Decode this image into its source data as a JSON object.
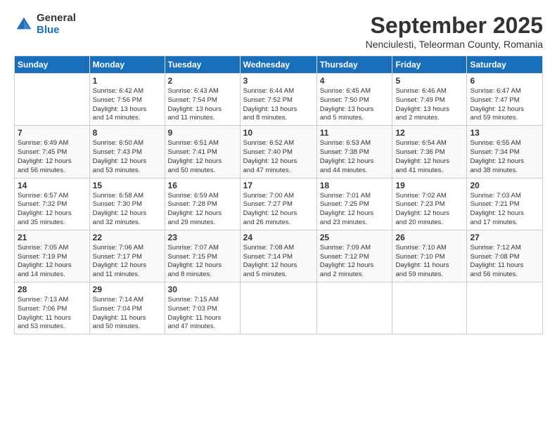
{
  "logo": {
    "general": "General",
    "blue": "Blue"
  },
  "title": "September 2025",
  "subtitle": "Nenciulesti, Teleorman County, Romania",
  "days_header": [
    "Sunday",
    "Monday",
    "Tuesday",
    "Wednesday",
    "Thursday",
    "Friday",
    "Saturday"
  ],
  "weeks": [
    [
      {
        "num": "",
        "detail": ""
      },
      {
        "num": "1",
        "detail": "Sunrise: 6:42 AM\nSunset: 7:56 PM\nDaylight: 13 hours\nand 14 minutes."
      },
      {
        "num": "2",
        "detail": "Sunrise: 6:43 AM\nSunset: 7:54 PM\nDaylight: 13 hours\nand 11 minutes."
      },
      {
        "num": "3",
        "detail": "Sunrise: 6:44 AM\nSunset: 7:52 PM\nDaylight: 13 hours\nand 8 minutes."
      },
      {
        "num": "4",
        "detail": "Sunrise: 6:45 AM\nSunset: 7:50 PM\nDaylight: 13 hours\nand 5 minutes."
      },
      {
        "num": "5",
        "detail": "Sunrise: 6:46 AM\nSunset: 7:49 PM\nDaylight: 13 hours\nand 2 minutes."
      },
      {
        "num": "6",
        "detail": "Sunrise: 6:47 AM\nSunset: 7:47 PM\nDaylight: 12 hours\nand 59 minutes."
      }
    ],
    [
      {
        "num": "7",
        "detail": "Sunrise: 6:49 AM\nSunset: 7:45 PM\nDaylight: 12 hours\nand 56 minutes."
      },
      {
        "num": "8",
        "detail": "Sunrise: 6:50 AM\nSunset: 7:43 PM\nDaylight: 12 hours\nand 53 minutes."
      },
      {
        "num": "9",
        "detail": "Sunrise: 6:51 AM\nSunset: 7:41 PM\nDaylight: 12 hours\nand 50 minutes."
      },
      {
        "num": "10",
        "detail": "Sunrise: 6:52 AM\nSunset: 7:40 PM\nDaylight: 12 hours\nand 47 minutes."
      },
      {
        "num": "11",
        "detail": "Sunrise: 6:53 AM\nSunset: 7:38 PM\nDaylight: 12 hours\nand 44 minutes."
      },
      {
        "num": "12",
        "detail": "Sunrise: 6:54 AM\nSunset: 7:36 PM\nDaylight: 12 hours\nand 41 minutes."
      },
      {
        "num": "13",
        "detail": "Sunrise: 6:55 AM\nSunset: 7:34 PM\nDaylight: 12 hours\nand 38 minutes."
      }
    ],
    [
      {
        "num": "14",
        "detail": "Sunrise: 6:57 AM\nSunset: 7:32 PM\nDaylight: 12 hours\nand 35 minutes."
      },
      {
        "num": "15",
        "detail": "Sunrise: 6:58 AM\nSunset: 7:30 PM\nDaylight: 12 hours\nand 32 minutes."
      },
      {
        "num": "16",
        "detail": "Sunrise: 6:59 AM\nSunset: 7:28 PM\nDaylight: 12 hours\nand 29 minutes."
      },
      {
        "num": "17",
        "detail": "Sunrise: 7:00 AM\nSunset: 7:27 PM\nDaylight: 12 hours\nand 26 minutes."
      },
      {
        "num": "18",
        "detail": "Sunrise: 7:01 AM\nSunset: 7:25 PM\nDaylight: 12 hours\nand 23 minutes."
      },
      {
        "num": "19",
        "detail": "Sunrise: 7:02 AM\nSunset: 7:23 PM\nDaylight: 12 hours\nand 20 minutes."
      },
      {
        "num": "20",
        "detail": "Sunrise: 7:03 AM\nSunset: 7:21 PM\nDaylight: 12 hours\nand 17 minutes."
      }
    ],
    [
      {
        "num": "21",
        "detail": "Sunrise: 7:05 AM\nSunset: 7:19 PM\nDaylight: 12 hours\nand 14 minutes."
      },
      {
        "num": "22",
        "detail": "Sunrise: 7:06 AM\nSunset: 7:17 PM\nDaylight: 12 hours\nand 11 minutes."
      },
      {
        "num": "23",
        "detail": "Sunrise: 7:07 AM\nSunset: 7:15 PM\nDaylight: 12 hours\nand 8 minutes."
      },
      {
        "num": "24",
        "detail": "Sunrise: 7:08 AM\nSunset: 7:14 PM\nDaylight: 12 hours\nand 5 minutes."
      },
      {
        "num": "25",
        "detail": "Sunrise: 7:09 AM\nSunset: 7:12 PM\nDaylight: 12 hours\nand 2 minutes."
      },
      {
        "num": "26",
        "detail": "Sunrise: 7:10 AM\nSunset: 7:10 PM\nDaylight: 11 hours\nand 59 minutes."
      },
      {
        "num": "27",
        "detail": "Sunrise: 7:12 AM\nSunset: 7:08 PM\nDaylight: 11 hours\nand 56 minutes."
      }
    ],
    [
      {
        "num": "28",
        "detail": "Sunrise: 7:13 AM\nSunset: 7:06 PM\nDaylight: 11 hours\nand 53 minutes."
      },
      {
        "num": "29",
        "detail": "Sunrise: 7:14 AM\nSunset: 7:04 PM\nDaylight: 11 hours\nand 50 minutes."
      },
      {
        "num": "30",
        "detail": "Sunrise: 7:15 AM\nSunset: 7:03 PM\nDaylight: 11 hours\nand 47 minutes."
      },
      {
        "num": "",
        "detail": ""
      },
      {
        "num": "",
        "detail": ""
      },
      {
        "num": "",
        "detail": ""
      },
      {
        "num": "",
        "detail": ""
      }
    ]
  ]
}
